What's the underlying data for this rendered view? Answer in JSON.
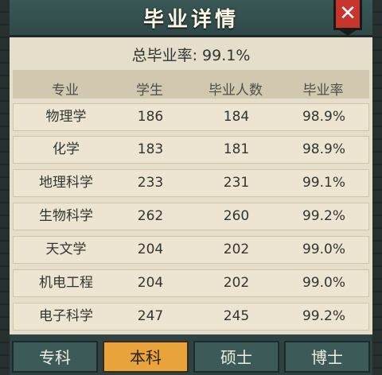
{
  "window": {
    "title": "毕业详情",
    "close_symbol": "✕"
  },
  "summary": {
    "label": "总毕业率:",
    "value": "99.1%"
  },
  "table": {
    "headers": [
      "专业",
      "学生",
      "毕业人数",
      "毕业率"
    ],
    "rows": [
      [
        "物理学",
        "186",
        "184",
        "98.9%"
      ],
      [
        "化学",
        "183",
        "181",
        "98.9%"
      ],
      [
        "地理科学",
        "233",
        "231",
        "99.1%"
      ],
      [
        "生物科学",
        "262",
        "260",
        "99.2%"
      ],
      [
        "天文学",
        "204",
        "202",
        "99.0%"
      ],
      [
        "机电工程",
        "204",
        "202",
        "99.0%"
      ],
      [
        "电子科学",
        "247",
        "245",
        "99.2%"
      ]
    ]
  },
  "tabs": [
    {
      "label": "专科",
      "active": false
    },
    {
      "label": "本科",
      "active": true
    },
    {
      "label": "硕士",
      "active": false
    },
    {
      "label": "博士",
      "active": false
    }
  ],
  "colors": {
    "accent": "#e8a43a",
    "close": "#c7352c",
    "frame": "#2d3f3e",
    "panel": "#e5decb"
  }
}
